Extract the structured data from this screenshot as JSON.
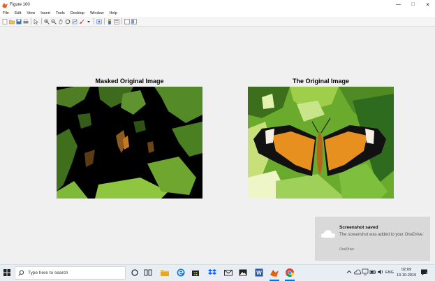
{
  "window": {
    "title": "Figure 100",
    "min_glyph": "—",
    "max_glyph": "□",
    "close_glyph": "✕"
  },
  "menu": [
    "File",
    "Edit",
    "View",
    "Insert",
    "Tools",
    "Desktop",
    "Window",
    "Help"
  ],
  "toolbar_icons": [
    "new-figure-icon",
    "open-file-icon",
    "save-icon",
    "print-icon",
    "edit-plot-icon",
    "zoom-in-icon",
    "zoom-out-icon",
    "pan-icon",
    "rotate-3d-icon",
    "data-cursor-icon",
    "brush-icon",
    "link-plot-icon",
    "colorbar-icon",
    "legend-icon",
    "hide-plot-tools-icon",
    "show-plot-tools-icon"
  ],
  "axes": [
    {
      "title": "Masked Original Image"
    },
    {
      "title": "The Original Image"
    }
  ],
  "toast": {
    "title": "Screenshot saved",
    "message": "The screenshot was added to your OneDrive.",
    "source": "OneDrive"
  },
  "taskbar": {
    "search_placeholder": "Type here to search",
    "language": "ENG",
    "time": "02:09",
    "date": "13-10-2019",
    "apps": [
      "cortana-icon",
      "task-view-icon",
      "file-explorer-icon",
      "edge-icon",
      "store-icon",
      "dropbox-icon",
      "mail-icon",
      "photos-icon",
      "word-icon",
      "matlab-icon",
      "chrome-icon"
    ]
  },
  "colors": {
    "accent": "#0078d7",
    "butterfly_orange": "#e8901f",
    "leaf_green": "#6aaa2c"
  }
}
